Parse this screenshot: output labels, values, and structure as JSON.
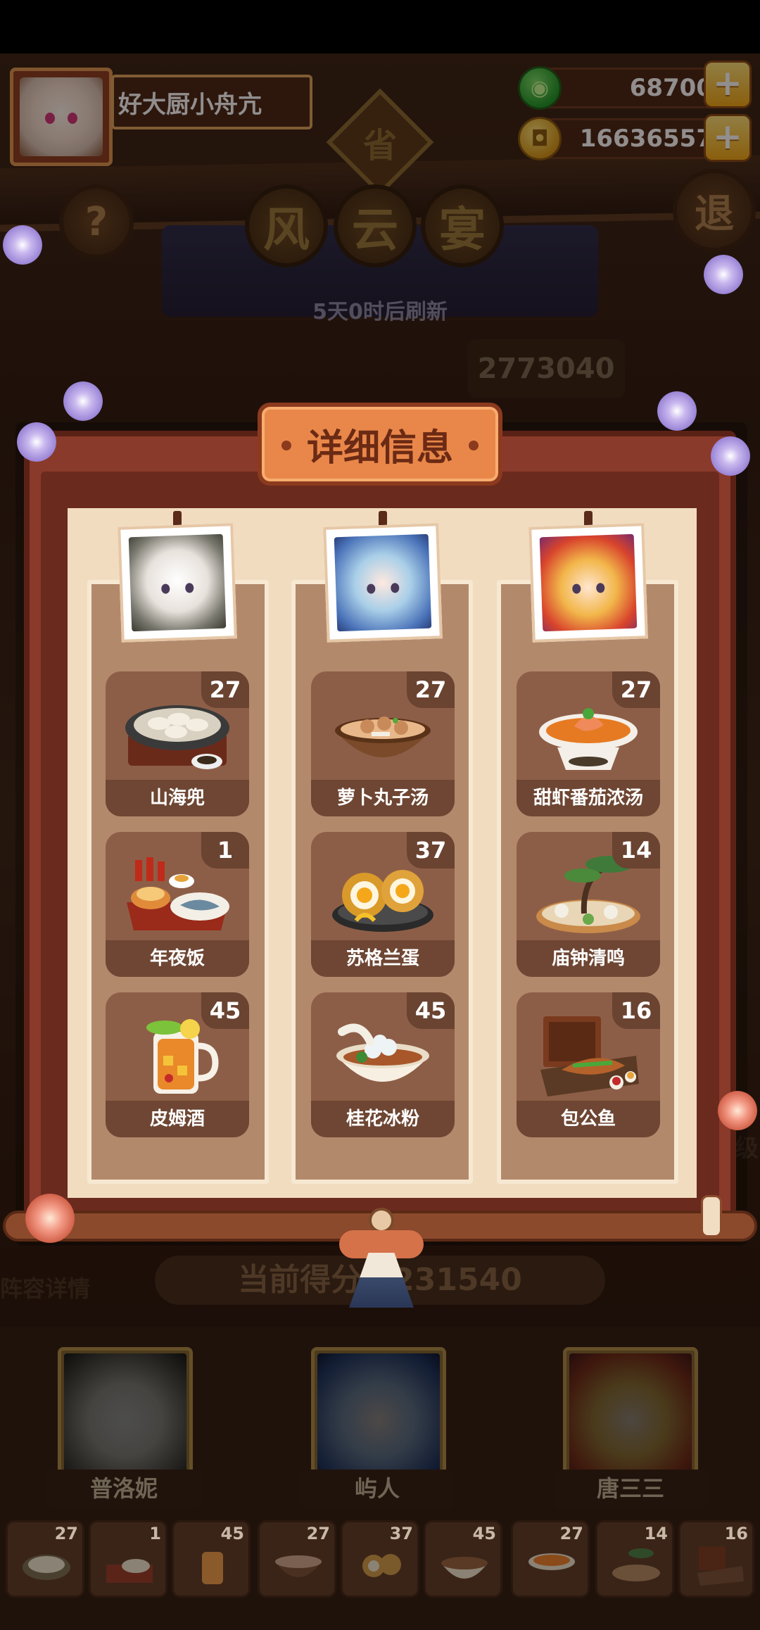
{
  "player": {
    "name": "好大厨小舟亢",
    "jade": "68700",
    "coins": "16636557"
  },
  "buttons": {
    "help": "?",
    "quit": "退",
    "plus": "+"
  },
  "event": {
    "province_badge": "省",
    "title_chars": [
      "风",
      "云",
      "宴"
    ],
    "refresh_text": "5天0时后刷新",
    "score_top": "2773040"
  },
  "panel": {
    "title": "详细信息",
    "columns": [
      {
        "character": "普洛妮",
        "dishes": [
          {
            "name": "山海兜",
            "count": "27",
            "icon": "dumpling-dish-icon"
          },
          {
            "name": "年夜饭",
            "count": "1",
            "icon": "new-year-feast-icon"
          },
          {
            "name": "皮姆酒",
            "count": "45",
            "icon": "pimms-drink-icon"
          }
        ]
      },
      {
        "character": "屿人",
        "dishes": [
          {
            "name": "萝卜丸子汤",
            "count": "27",
            "icon": "radish-meatball-soup-icon"
          },
          {
            "name": "苏格兰蛋",
            "count": "37",
            "icon": "scotch-egg-icon"
          },
          {
            "name": "桂花冰粉",
            "count": "45",
            "icon": "osmanthus-ice-jelly-icon"
          }
        ]
      },
      {
        "character": "唐三三",
        "dishes": [
          {
            "name": "甜虾番茄浓汤",
            "count": "27",
            "icon": "shrimp-tomato-soup-icon"
          },
          {
            "name": "庙钟清鸣",
            "count": "14",
            "icon": "temple-bell-platter-icon"
          },
          {
            "name": "包公鱼",
            "count": "16",
            "icon": "baogong-fish-icon"
          }
        ]
      }
    ]
  },
  "background": {
    "current_score": "当前得分：231540",
    "lineup_label": "阵容详情",
    "level_hint": "级",
    "characters": [
      "普洛妮",
      "屿人",
      "唐三三"
    ],
    "mini_counts": [
      "27",
      "1",
      "45",
      "27",
      "37",
      "45",
      "27",
      "14",
      "16"
    ]
  },
  "colors": {
    "panel_frame": "#8a3a2a",
    "paper": "#f1dcc0",
    "dish_card": "#8d5e47",
    "plaque": "#e9874a",
    "plus_button": "#f2a916"
  }
}
